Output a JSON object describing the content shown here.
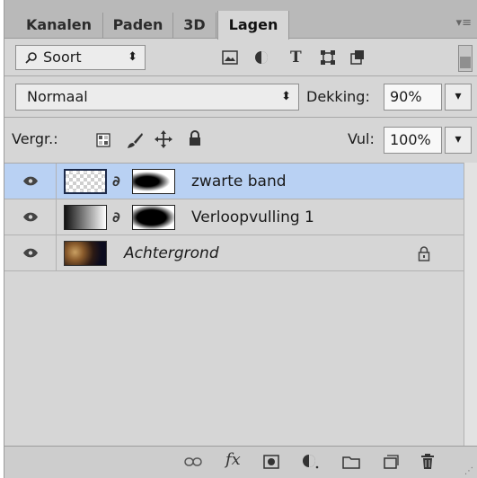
{
  "tabs": [
    {
      "label": "Kanalen"
    },
    {
      "label": "Paden"
    },
    {
      "label": "3D"
    },
    {
      "label": "Lagen"
    }
  ],
  "filter": {
    "kind_icon": "search-icon",
    "kind_label": "Soort",
    "filter_icons": [
      "image-filter-icon",
      "adjustment-filter-icon",
      "type-filter-icon",
      "shape-filter-icon",
      "smart-object-filter-icon"
    ],
    "type_glyph": "T"
  },
  "blend": {
    "mode": "Normaal",
    "opacity_label": "Dekking:",
    "opacity_value": "90%"
  },
  "lock": {
    "label": "Vergr.:",
    "fill_label": "Vul:",
    "fill_value": "100%"
  },
  "layers": [
    {
      "name": "zwarte band",
      "selected": true,
      "italic": false,
      "visible": true
    },
    {
      "name": "Verloopvulling 1",
      "selected": false,
      "italic": false,
      "visible": true
    },
    {
      "name": "Achtergrond",
      "selected": false,
      "italic": true,
      "visible": true,
      "locked": true
    }
  ],
  "bottom_bar": {
    "fx_label": "fx"
  },
  "colors": {
    "panel": "#d6d6d6",
    "tabbar": "#b9b9b9",
    "selection": "#b9d1f3"
  }
}
